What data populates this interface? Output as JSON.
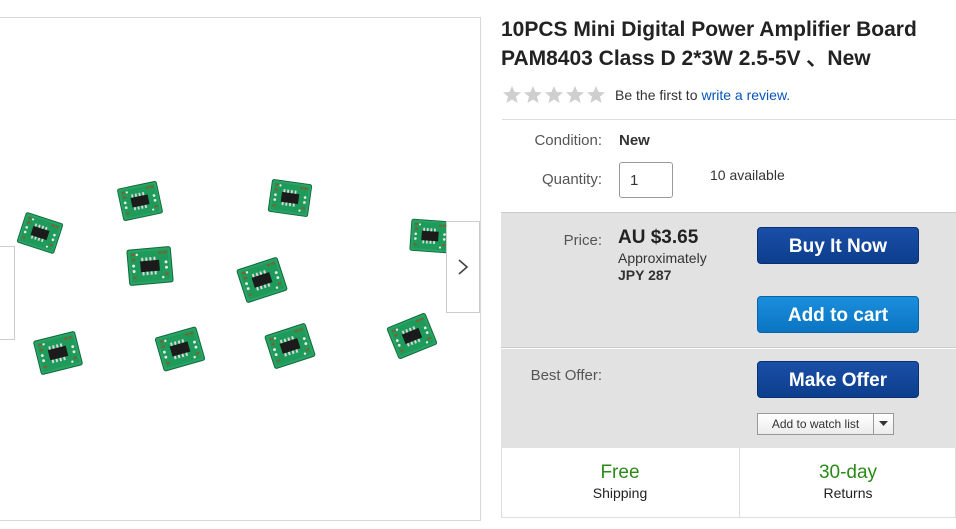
{
  "product": {
    "title": "10PCS Mini Digital Power Amplifier Board PAM8403 Class D 2*3W 2.5-5V 、New"
  },
  "rating": {
    "prefix": "Be the first to",
    "link": "write a review."
  },
  "details": {
    "condition_label": "Condition:",
    "condition_value": "New",
    "quantity_label": "Quantity:",
    "quantity_value": "1",
    "available": "10 available"
  },
  "price": {
    "label": "Price:",
    "amount": "AU $3.65",
    "approx_label": "Approximately",
    "approx_amount": "JPY 287"
  },
  "buttons": {
    "buy_now": "Buy It Now",
    "add_to_cart": "Add to cart",
    "make_offer": "Make Offer",
    "watch_list": "Add to watch list"
  },
  "best_offer": {
    "label": "Best Offer:"
  },
  "shipping": {
    "big": "Free",
    "small": "Shipping"
  },
  "returns": {
    "big": "30-day",
    "small": "Returns"
  },
  "colors": {
    "link": "#0654ba",
    "buy_button": "#0d3e8d",
    "cart_button": "#0a74c2",
    "free_green": "#2a8a18",
    "pcb_green": "#1e9a5a"
  },
  "icons": {
    "star": "star-icon",
    "next": "chevron-right-icon",
    "dropdown": "caret-down-icon"
  }
}
